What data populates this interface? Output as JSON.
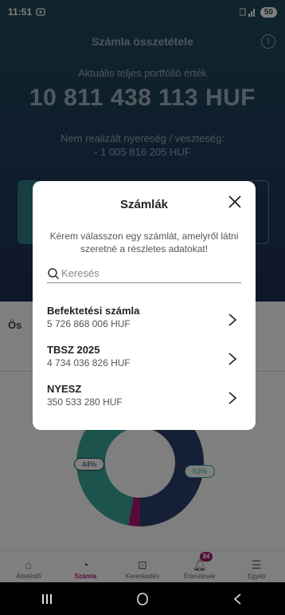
{
  "status": {
    "time": "11:51",
    "battery": "50"
  },
  "header": {
    "title": "Számla összetétele"
  },
  "portfolio": {
    "label": "Aktuális teljes portfólió érték",
    "value": "10 811 438 113 HUF",
    "pl_label": "Nem realizált nyereség / veszteség:",
    "pl_value": "- 1 005 816 205 HUF"
  },
  "section": {
    "label": "Ös"
  },
  "donut": {
    "left_label": "44%",
    "right_label": "53%",
    "shares": [
      0.44,
      0.53,
      0.03
    ],
    "colors": [
      "#2a3f6b",
      "#3aa69a",
      "#a8196e"
    ]
  },
  "tabs": [
    {
      "label": "Áttekintő",
      "icon": "home-icon",
      "glyph": "⌂"
    },
    {
      "label": "Számla",
      "icon": "pie-chart-icon",
      "glyph": "◔"
    },
    {
      "label": "Kereskedés",
      "icon": "trade-icon",
      "glyph": "⊡"
    },
    {
      "label": "Értesítések",
      "icon": "bell-icon",
      "glyph": "🔔︎",
      "badge": "84"
    },
    {
      "label": "Egyéb",
      "icon": "menu-icon",
      "glyph": "☰"
    }
  ],
  "modal": {
    "title": "Számlák",
    "description": "Kérem válasszon egy számlát, amelyről látni szeretné a részletes adatokat!",
    "search_placeholder": "Keresés",
    "accounts": [
      {
        "name": "Befektetési számla",
        "balance": "5 726 868 006 HUF"
      },
      {
        "name": "TBSZ 2025",
        "balance": "4 734 036 826 HUF"
      },
      {
        "name": "NYESZ",
        "balance": "350 533 280 HUF"
      }
    ]
  },
  "navbar": {
    "back_icon": "back-icon",
    "home_icon": "home-nav-icon",
    "recents_icon": "recents-icon"
  }
}
